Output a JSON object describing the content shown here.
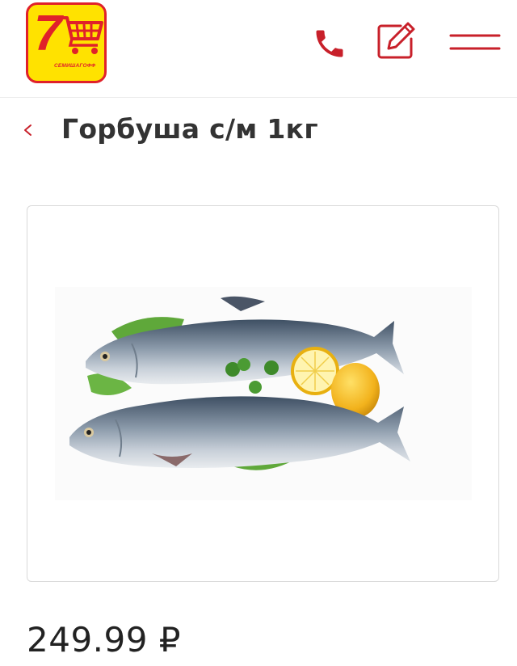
{
  "header": {
    "logo_text": "СЕМИШАГОФФ",
    "logo_digit": "7",
    "icons": [
      "phone-icon",
      "edit-icon",
      "menu-icon"
    ]
  },
  "product": {
    "title": "Горбуша с/м 1кг",
    "price": "249.99 ₽",
    "image": "fish-image"
  },
  "colors": {
    "accent": "#c8202a",
    "logo_yellow": "#ffe200",
    "logo_red": "#e0212a",
    "text": "#333333"
  }
}
